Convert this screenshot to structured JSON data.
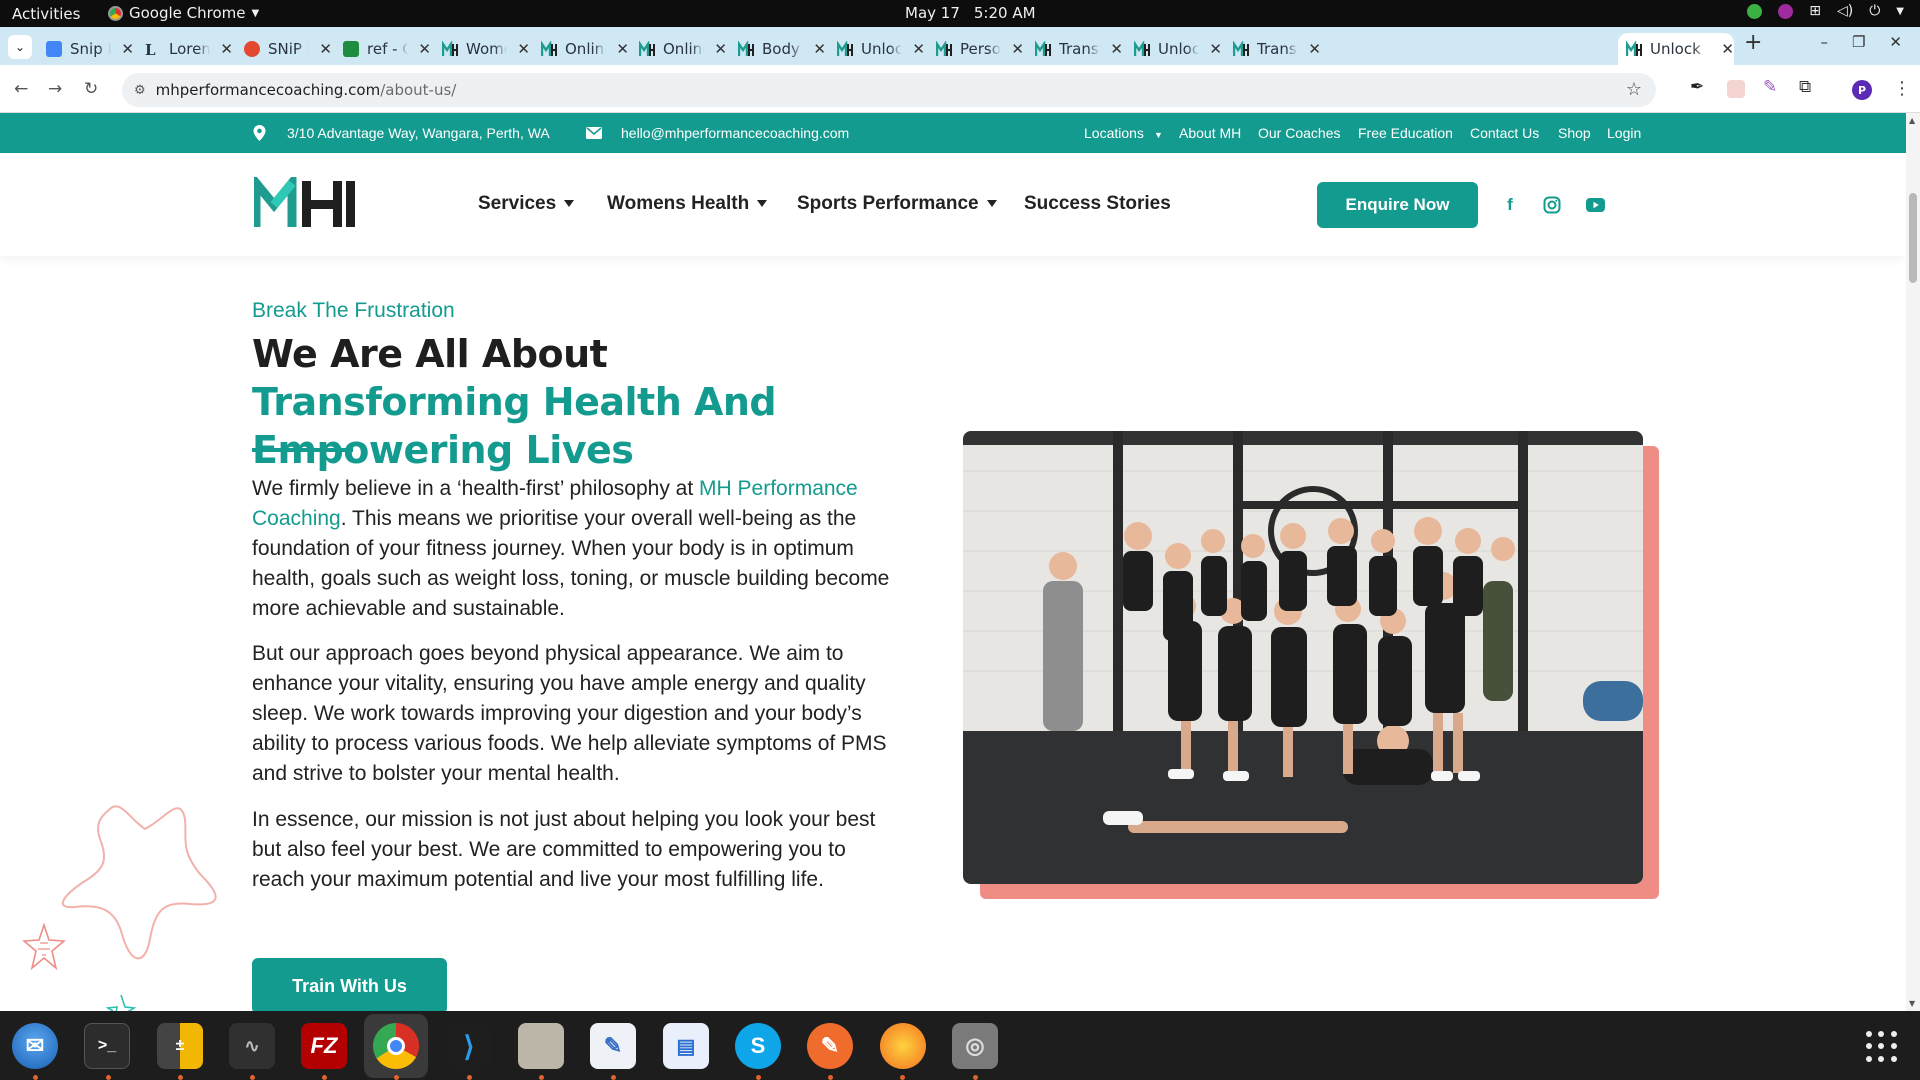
{
  "system": {
    "activities": "Activities",
    "app_name": "Google Chrome",
    "date": "May 17",
    "time": "5:20 AM"
  },
  "browser": {
    "tabs": [
      {
        "label": "Snip De",
        "favicon": "google-docs-icon"
      },
      {
        "label": "Lorem I",
        "favicon": "lorem-ipsum-icon"
      },
      {
        "label": "SNiP Nu",
        "favicon": "snip-icon"
      },
      {
        "label": "ref - Go",
        "favicon": "google-sheets-icon"
      },
      {
        "label": "Women",
        "favicon": "mh-icon"
      },
      {
        "label": "Online",
        "favicon": "mh-icon"
      },
      {
        "label": "Online",
        "favicon": "mh-icon"
      },
      {
        "label": "Body Tr",
        "favicon": "mh-icon"
      },
      {
        "label": "Unlock",
        "favicon": "mh-icon"
      },
      {
        "label": "Person",
        "favicon": "mh-icon"
      },
      {
        "label": "Transfo",
        "favicon": "mh-icon"
      },
      {
        "label": "Unlock",
        "favicon": "mh-icon"
      },
      {
        "label": "Transfo",
        "favicon": "mh-icon"
      },
      {
        "label": "Unlock",
        "favicon": "mh-icon"
      }
    ],
    "url_host": "mhperformancecoaching.com",
    "url_path": "/about-us/",
    "profile_initial": "P"
  },
  "site": {
    "brand_color": "#149b8f",
    "accent_coral": "#ef8d85",
    "address": "3/10 Advantage Way, Wangara, Perth, WA",
    "email": "hello@mhperformancecoaching.com",
    "top_links": [
      "Locations",
      "About MH",
      "Our Coaches",
      "Free Education",
      "Contact Us",
      "Shop",
      "Login"
    ],
    "logo_text": "MH",
    "menu": [
      "Services",
      "Womens Health",
      "Sports Performance",
      "Success Stories"
    ],
    "enquire": "Enquire Now",
    "social": {
      "facebook": "f",
      "instagram": "instagram-icon",
      "youtube": "youtube-icon"
    }
  },
  "content": {
    "kicker": "Break The Frustration",
    "headline_plain": "We Are All About ",
    "headline_accent": "Transforming Health And Empowering Lives",
    "para1_before": "We firmly believe in a ‘health-first’ philosophy at ",
    "para1_link": "MH Performance Coaching",
    "para1_after": ". This means we prioritise your overall well-being as the foundation of your fitness journey. When your body is in optimum health, goals such as weight loss, toning, or muscle building become more achievable and sustainable.",
    "para2": "But our approach goes beyond physical appearance. We aim to enhance your vitality, ensuring you have ample energy and quality sleep. We work towards improving your digestion and your body’s ability to process various foods. We help alleviate symptoms of PMS and strive to bolster your mental health.",
    "para3": "In essence, our mission is not just about helping you look your best but also feel your best. We are committed to empowering you to reach your maximum potential and live your most fulfilling life.",
    "cta": "Train With Us"
  },
  "dock": [
    "thunderbird-icon",
    "terminal-icon",
    "calculator-icon",
    "system-monitor-icon",
    "filezilla-icon",
    "chrome-icon",
    "vscode-icon",
    "files-icon",
    "text-editor-icon",
    "writer-icon",
    "skype-icon",
    "postman-icon",
    "firefox-dev-icon",
    "disk-icon"
  ]
}
